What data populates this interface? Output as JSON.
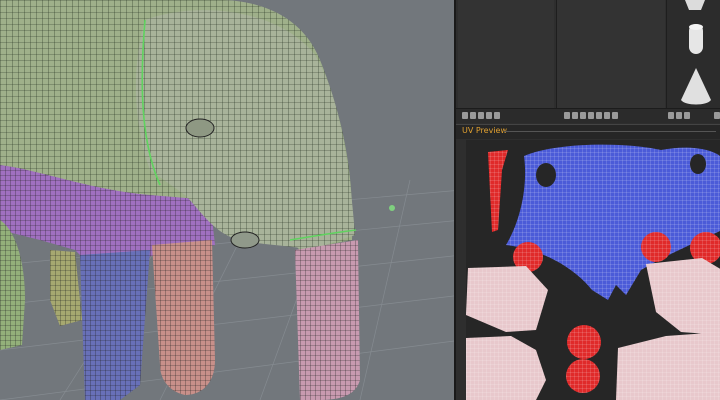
{
  "uv_panel": {
    "title": "UV Preview"
  },
  "colors": {
    "viewport_bg": "#72777c",
    "panel_bg": "#2e2e2e",
    "uv_title": "#e0a030",
    "uv_blue": "#4b5bd8",
    "uv_red": "#e02a2a",
    "mesh_green": "#9fb08a",
    "mesh_purple": "#a070c0",
    "mesh_blue": "#6870b8",
    "mesh_pink": "#c8908a"
  },
  "icons": [
    "cube-icon",
    "cylinder-icon",
    "cone-icon"
  ]
}
